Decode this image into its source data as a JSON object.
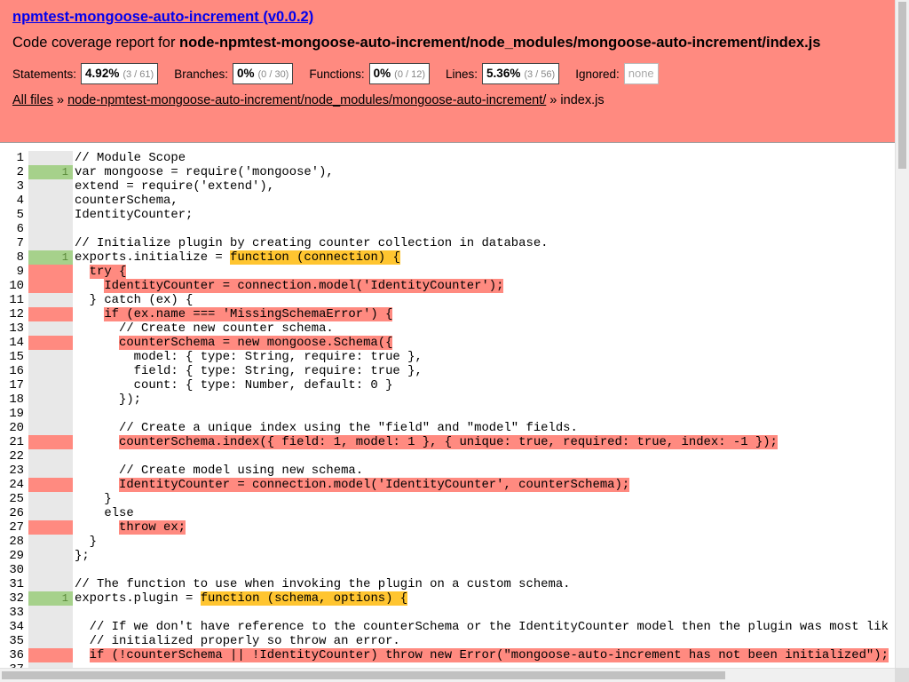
{
  "header": {
    "project_title": "npmtest-mongoose-auto-increment (v0.0.2)",
    "report_prefix": "Code coverage report for ",
    "report_path": "node-npmtest-mongoose-auto-increment/node_modules/mongoose-auto-increment/index.js",
    "stats": {
      "statements": {
        "label": "Statements:",
        "pct": "4.92%",
        "frac": "(3 / 61)"
      },
      "branches": {
        "label": "Branches:",
        "pct": "0%",
        "frac": "(0 / 30)"
      },
      "functions": {
        "label": "Functions:",
        "pct": "0%",
        "frac": "(0 / 12)"
      },
      "lines": {
        "label": "Lines:",
        "pct": "5.36%",
        "frac": "(3 / 56)"
      },
      "ignored": {
        "label": "Ignored:",
        "value": "none"
      }
    },
    "breadcrumbs": {
      "all_files": "All files",
      "sep1": " » ",
      "folder": "node-npmtest-mongoose-auto-increment/node_modules/mongoose-auto-increment/",
      "sep2": " » ",
      "file": "index.js"
    }
  },
  "colors": {
    "header_bg": "#ff8a80",
    "covered": "#a6d18b",
    "missed": "#ff8a80",
    "function_not_covered": "#ffc530"
  },
  "code_lines": [
    {
      "n": "1",
      "hits": "",
      "status": "neutral",
      "segments": [
        {
          "t": "// Module Scope"
        }
      ]
    },
    {
      "n": "2",
      "hits": "1",
      "status": "covered",
      "segments": [
        {
          "t": "var mongoose = require('mongoose'),"
        }
      ]
    },
    {
      "n": "3",
      "hits": "",
      "status": "neutral",
      "segments": [
        {
          "t": "extend = require('extend'),"
        }
      ]
    },
    {
      "n": "4",
      "hits": "",
      "status": "neutral",
      "segments": [
        {
          "t": "counterSchema,"
        }
      ]
    },
    {
      "n": "5",
      "hits": "",
      "status": "neutral",
      "segments": [
        {
          "t": "IdentityCounter;"
        }
      ]
    },
    {
      "n": "6",
      "hits": "",
      "status": "neutral",
      "segments": [
        {
          "t": ""
        }
      ]
    },
    {
      "n": "7",
      "hits": "",
      "status": "neutral",
      "segments": [
        {
          "t": "// Initialize plugin by creating counter collection in database."
        }
      ]
    },
    {
      "n": "8",
      "hits": "1",
      "status": "covered",
      "segments": [
        {
          "t": "exports.initialize = "
        },
        {
          "t": "function (connection) {",
          "hl": "fn"
        }
      ]
    },
    {
      "n": "9",
      "hits": "",
      "status": "missed",
      "segments": [
        {
          "t": "  "
        },
        {
          "t": "try {",
          "hl": "red"
        }
      ]
    },
    {
      "n": "10",
      "hits": "",
      "status": "missed",
      "segments": [
        {
          "t": "    "
        },
        {
          "t": "IdentityCounter = connection.model('IdentityCounter');",
          "hl": "red"
        }
      ]
    },
    {
      "n": "11",
      "hits": "",
      "status": "neutral",
      "segments": [
        {
          "t": "  } catch (ex) {"
        }
      ]
    },
    {
      "n": "12",
      "hits": "",
      "status": "missed",
      "segments": [
        {
          "t": "    "
        },
        {
          "t": "if (ex.name === 'MissingSchemaError') {",
          "hl": "red"
        }
      ]
    },
    {
      "n": "13",
      "hits": "",
      "status": "neutral",
      "segments": [
        {
          "t": "      // Create new counter schema."
        }
      ]
    },
    {
      "n": "14",
      "hits": "",
      "status": "missed",
      "segments": [
        {
          "t": "      "
        },
        {
          "t": "counterSchema = new mongoose.Schema({",
          "hl": "red"
        }
      ]
    },
    {
      "n": "15",
      "hits": "",
      "status": "neutral",
      "segments": [
        {
          "t": "        model: { type: String, require: true },"
        }
      ]
    },
    {
      "n": "16",
      "hits": "",
      "status": "neutral",
      "segments": [
        {
          "t": "        field: { type: String, require: true },"
        }
      ]
    },
    {
      "n": "17",
      "hits": "",
      "status": "neutral",
      "segments": [
        {
          "t": "        count: { type: Number, default: 0 }"
        }
      ]
    },
    {
      "n": "18",
      "hits": "",
      "status": "neutral",
      "segments": [
        {
          "t": "      });"
        }
      ]
    },
    {
      "n": "19",
      "hits": "",
      "status": "neutral",
      "segments": [
        {
          "t": ""
        }
      ]
    },
    {
      "n": "20",
      "hits": "",
      "status": "neutral",
      "segments": [
        {
          "t": "      // Create a unique index using the \"field\" and \"model\" fields."
        }
      ]
    },
    {
      "n": "21",
      "hits": "",
      "status": "missed",
      "segments": [
        {
          "t": "      "
        },
        {
          "t": "counterSchema.index({ field: 1, model: 1 }, { unique: true, required: true, index: -1 });",
          "hl": "red"
        }
      ]
    },
    {
      "n": "22",
      "hits": "",
      "status": "neutral",
      "segments": [
        {
          "t": ""
        }
      ]
    },
    {
      "n": "23",
      "hits": "",
      "status": "neutral",
      "segments": [
        {
          "t": "      // Create model using new schema."
        }
      ]
    },
    {
      "n": "24",
      "hits": "",
      "status": "missed",
      "segments": [
        {
          "t": "      "
        },
        {
          "t": "IdentityCounter = connection.model('IdentityCounter', counterSchema);",
          "hl": "red"
        }
      ]
    },
    {
      "n": "25",
      "hits": "",
      "status": "neutral",
      "segments": [
        {
          "t": "    }"
        }
      ]
    },
    {
      "n": "26",
      "hits": "",
      "status": "neutral",
      "segments": [
        {
          "t": "    else"
        }
      ]
    },
    {
      "n": "27",
      "hits": "",
      "status": "missed",
      "segments": [
        {
          "t": "      "
        },
        {
          "t": "throw ex;",
          "hl": "red"
        }
      ]
    },
    {
      "n": "28",
      "hits": "",
      "status": "neutral",
      "segments": [
        {
          "t": "  }"
        }
      ]
    },
    {
      "n": "29",
      "hits": "",
      "status": "neutral",
      "segments": [
        {
          "t": "};"
        }
      ]
    },
    {
      "n": "30",
      "hits": "",
      "status": "neutral",
      "segments": [
        {
          "t": ""
        }
      ]
    },
    {
      "n": "31",
      "hits": "",
      "status": "neutral",
      "segments": [
        {
          "t": "// The function to use when invoking the plugin on a custom schema."
        }
      ]
    },
    {
      "n": "32",
      "hits": "1",
      "status": "covered",
      "segments": [
        {
          "t": "exports.plugin = "
        },
        {
          "t": "function (schema, options) {",
          "hl": "fn"
        }
      ]
    },
    {
      "n": "33",
      "hits": "",
      "status": "neutral",
      "segments": [
        {
          "t": ""
        }
      ]
    },
    {
      "n": "34",
      "hits": "",
      "status": "neutral",
      "segments": [
        {
          "t": "  // If we don't have reference to the counterSchema or the IdentityCounter model then the plugin was most lik"
        }
      ]
    },
    {
      "n": "35",
      "hits": "",
      "status": "neutral",
      "segments": [
        {
          "t": "  // initialized properly so throw an error."
        }
      ]
    },
    {
      "n": "36",
      "hits": "",
      "status": "missed",
      "segments": [
        {
          "t": "  "
        },
        {
          "t": "if (!counterSchema || !IdentityCounter) throw new Error(\"mongoose-auto-increment has not been initialized\");",
          "hl": "red"
        }
      ]
    },
    {
      "n": "37",
      "hits": "",
      "status": "neutral",
      "segments": [
        {
          "t": ""
        }
      ]
    }
  ]
}
